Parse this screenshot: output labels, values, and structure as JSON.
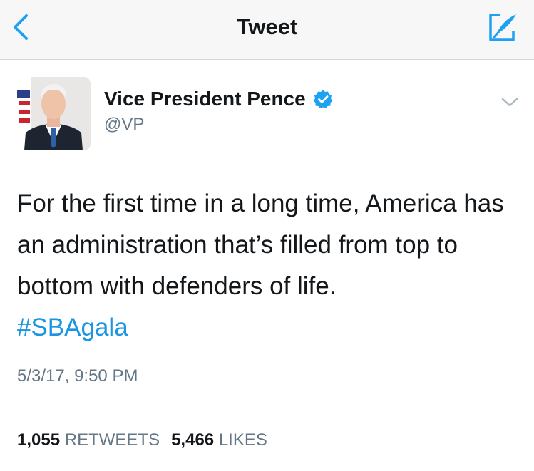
{
  "header": {
    "title": "Tweet",
    "back_icon": "chevron-left-icon",
    "compose_icon": "compose-tweet-icon",
    "accent_color": "#1da1f2"
  },
  "author": {
    "name": "Vice President Pence",
    "handle": "@VP",
    "verified_icon": "verified-badge-icon",
    "menu_icon": "chevron-down-icon"
  },
  "tweet": {
    "text": "For the first time in a long time, America has an administration that’s filled from top to bottom with defenders of life.",
    "hashtag": "#SBAgala",
    "hashtag_color": "#1b95e0",
    "timestamp": "5/3/17, 9:50 PM"
  },
  "stats": {
    "retweets_count": "1,055",
    "retweets_label": "RETWEETS",
    "likes_count": "5,466",
    "likes_label": "LIKES"
  }
}
